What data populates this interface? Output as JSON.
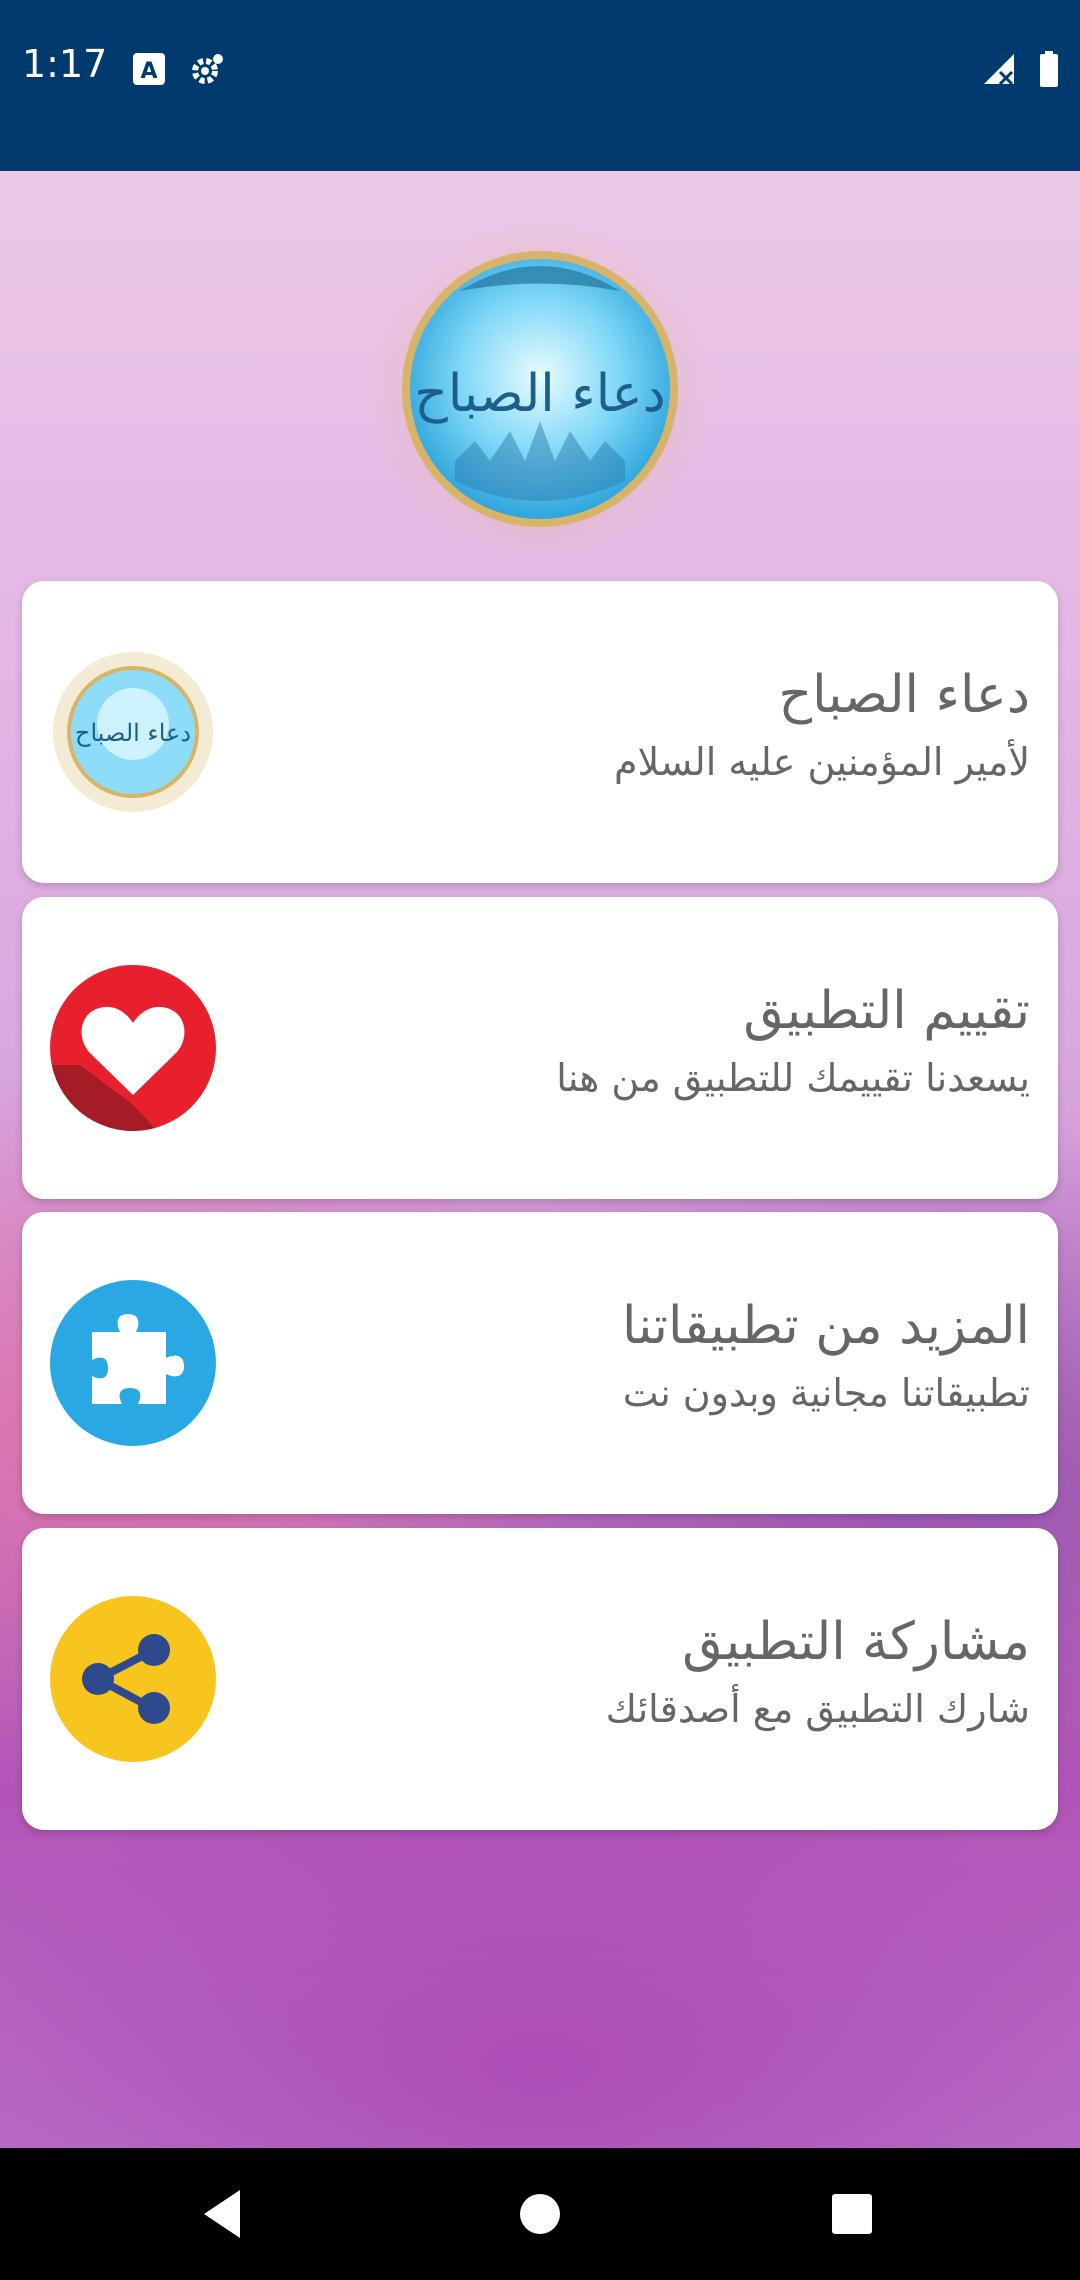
{
  "status_bar": {
    "time": "1:17"
  },
  "hero": {
    "logo_text": "دعاء الصباح"
  },
  "cards": [
    {
      "title": "دعاء الصباح",
      "subtitle": "لأمير المؤمنين عليه السلام",
      "icon": "dua-logo-icon",
      "color": "#4fc3f7"
    },
    {
      "title": "تقييم التطبيق",
      "subtitle": "يسعدنا تقييمك للتطبيق من هنا",
      "icon": "heart-icon",
      "color": "#e8202e"
    },
    {
      "title": "المزيد من تطبيقاتنا",
      "subtitle": "تطبيقاتنا مجانية وبدون نت",
      "icon": "puzzle-icon",
      "color": "#2aa8e4"
    },
    {
      "title": "مشاركة التطبيق",
      "subtitle": "شارك التطبيق مع أصدقائك",
      "icon": "share-icon",
      "color": "#f7c51e"
    }
  ],
  "nav": {
    "back": "back-icon",
    "home": "home-icon",
    "recents": "recents-icon"
  },
  "colors": {
    "status_bar": "#003a6e",
    "card_text": "#666666"
  }
}
